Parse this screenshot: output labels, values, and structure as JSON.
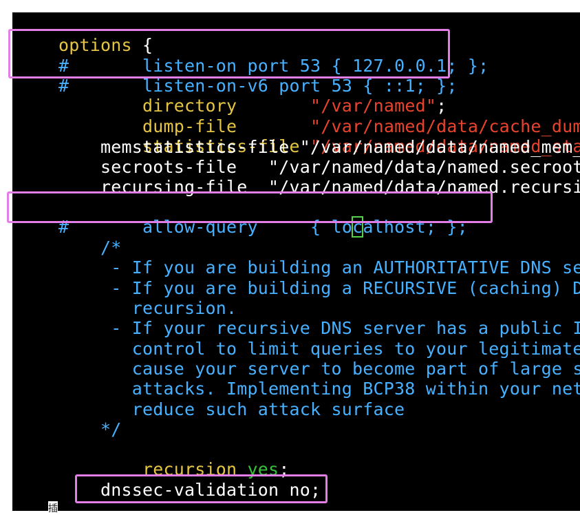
{
  "lines": {
    "l0_a": "options",
    "l0_b": " {",
    "l1_a": "#",
    "l1_b": "       listen-on port 53 { 127.0.0.1; };",
    "l2_a": "#",
    "l2_b": "       listen-on-v6 port 53 { ::1; };",
    "l3_a": "        directory",
    "l3_b": "       \"/var/named\"",
    "l3_c": ";",
    "l4_a": "        dump-file",
    "l4_b": "       \"/var/named/data/cache_dump.db",
    "l5_a": "        statistics-file",
    "l5_b": " \"/var/named/data/named_stats.t",
    "l6": "        memstatistics-file \"/var/named/data/named_mem_",
    "l7": "        secroots-file   \"/var/named/data/named.secroot",
    "l8": "        recursing-file  \"/var/named/data/named.recursi",
    "l9_a": "#",
    "l9_b": "       allow-query     { lo",
    "l9_cursor": "c",
    "l9_c": "alhost; };",
    "l11": "        /*",
    "l12": "         - If you are building an AUTHORITATIVE DNS se",
    "l13": "         - If you are building a RECURSIVE (caching) D",
    "l14": "           recursion.",
    "l15": "         - If your recursive DNS server has a public I",
    "l16": "           control to limit queries to your legitimate",
    "l17": "           cause your server to become part of large s",
    "l18": "           attacks. Implementing BCP38 within your net",
    "l19": "           reduce such attack surface",
    "l20": "        */",
    "l21_a": "        recursion",
    "l21_b": " yes",
    "l21_c": ";",
    "l23": "        dnssec-validation no;"
  },
  "bottom_text": "插",
  "colors": {
    "keyword": "#e6c542",
    "string": "#e8432d",
    "comment": "#48b1ff",
    "value_yes": "#35c23a",
    "highlight_box": "#e37ee6",
    "cursor": "#54d34a"
  }
}
